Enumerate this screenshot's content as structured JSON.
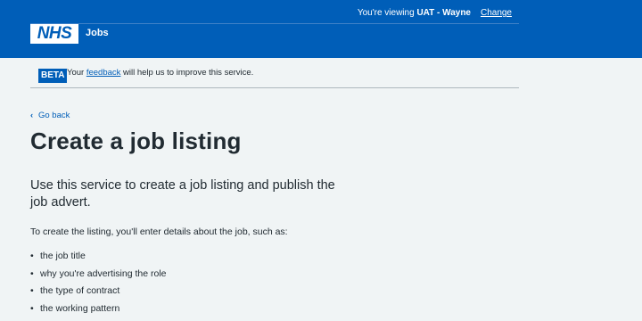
{
  "header": {
    "viewing_prefix": "You're viewing",
    "viewing_env": "UAT - Wayne",
    "change_label": "Change",
    "logo_text": "NHS",
    "service_name": "Jobs"
  },
  "phase_banner": {
    "tag": "BETA",
    "text_before": "Your",
    "link_text": "feedback",
    "text_after": "will help us to improve this service."
  },
  "back_link": "Go back",
  "page_title": "Create a job listing",
  "lede": "Use this service to create a job listing and publish the job advert.",
  "intro": "To create the listing, you'll enter details about the job, such as:",
  "bullets": [
    "the job title",
    "why you're advertising the role",
    "the type of contract",
    "the working pattern"
  ],
  "colors": {
    "brand_blue": "#005eb8",
    "background": "#f0f4f5",
    "text": "#212b32"
  }
}
